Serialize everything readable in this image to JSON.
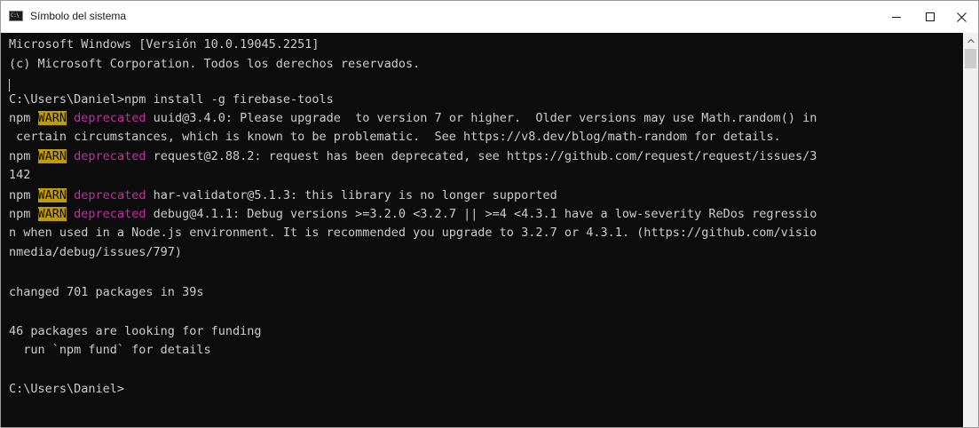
{
  "window": {
    "title": "Símbolo del sistema",
    "app_icon_text": "C:\\",
    "buttons": [
      "minimize-icon",
      "maximize-icon",
      "close-icon"
    ]
  },
  "console": {
    "colors": {
      "background": "#0c0c0c",
      "text": "#cccccc",
      "warn_bg": "#c19c00",
      "deprecated": "#c22ea0"
    },
    "lines": {
      "l1": "Microsoft Windows [Versión 10.0.19045.2251]",
      "l2": "(c) Microsoft Corporation. Todos los derechos reservados.",
      "l3": "C:\\Users\\Daniel>npm install -g firebase-tools",
      "w1": {
        "prefix": "npm ",
        "badge": "WARN",
        "tag": "deprecated",
        "msg": " uuid@3.4.0: Please upgrade  to version 7 or higher.  Older versions may use Math.random() in"
      },
      "l5": " certain circumstances, which is known to be problematic.  See https://v8.dev/blog/math-random for details.",
      "w2": {
        "prefix": "npm ",
        "badge": "WARN",
        "tag": "deprecated",
        "msg": " request@2.88.2: request has been deprecated, see https://github.com/request/request/issues/3"
      },
      "l7": "142",
      "w3": {
        "prefix": "npm ",
        "badge": "WARN",
        "tag": "deprecated",
        "msg": " har-validator@5.1.3: this library is no longer supported"
      },
      "w4": {
        "prefix": "npm ",
        "badge": "WARN",
        "tag": "deprecated",
        "msg": " debug@4.1.1: Debug versions >=3.2.0 <3.2.7 || >=4 <4.3.1 have a low-severity ReDos regressio"
      },
      "l10": "n when used in a Node.js environment. It is recommended you upgrade to 3.2.7 or 4.3.1. (https://github.com/visio",
      "l11": "nmedia/debug/issues/797)",
      "l12": "changed 701 packages in 39s",
      "l13": "46 packages are looking for funding",
      "l14": "  run `npm fund` for details",
      "l15": "C:\\Users\\Daniel>"
    }
  }
}
